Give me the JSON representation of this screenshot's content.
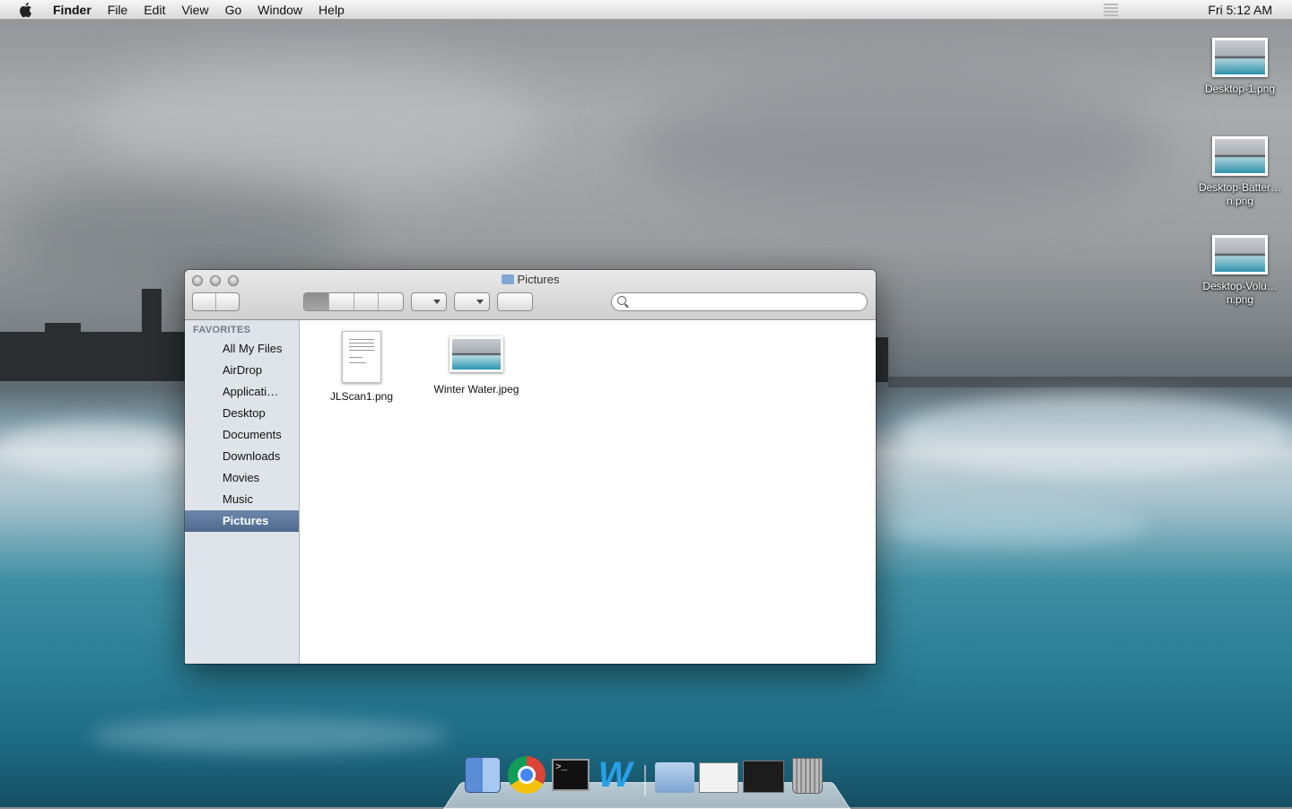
{
  "menubar": {
    "apple_icon": "apple-icon",
    "app_name": "Finder",
    "items": [
      "File",
      "Edit",
      "View",
      "Go",
      "Window",
      "Help"
    ],
    "clock": "Fri 5:12 AM"
  },
  "desktop": {
    "icons": [
      {
        "label": "Desktop-1.png",
        "icon": "image-thumbnail"
      },
      {
        "label": "Desktop-Batter…n.png",
        "icon": "image-thumbnail"
      },
      {
        "label": "Desktop-Volu…n.png",
        "icon": "image-thumbnail"
      }
    ]
  },
  "window": {
    "title": "Pictures",
    "title_icon": "folder-icon",
    "search": {
      "value": "",
      "placeholder": ""
    },
    "sidebar": {
      "heading": "FAVORITES",
      "items": [
        "All My Files",
        "AirDrop",
        "Applicati…",
        "Desktop",
        "Documents",
        "Downloads",
        "Movies",
        "Music",
        "Pictures"
      ],
      "selected": "Pictures"
    },
    "files": [
      {
        "name": "JLScan1.png",
        "icon": "document-thumbnail"
      },
      {
        "name": "Winter Water.jpeg",
        "icon": "image-thumbnail"
      }
    ]
  },
  "dock": {
    "apps": [
      "finder-icon",
      "chrome-icon",
      "terminal-icon",
      "w-app-icon"
    ],
    "stacks": [
      "folder-stack-icon",
      "browser-window-icon",
      "terminal-window-icon",
      "trash-icon"
    ],
    "terminal_prompt": ">_"
  }
}
